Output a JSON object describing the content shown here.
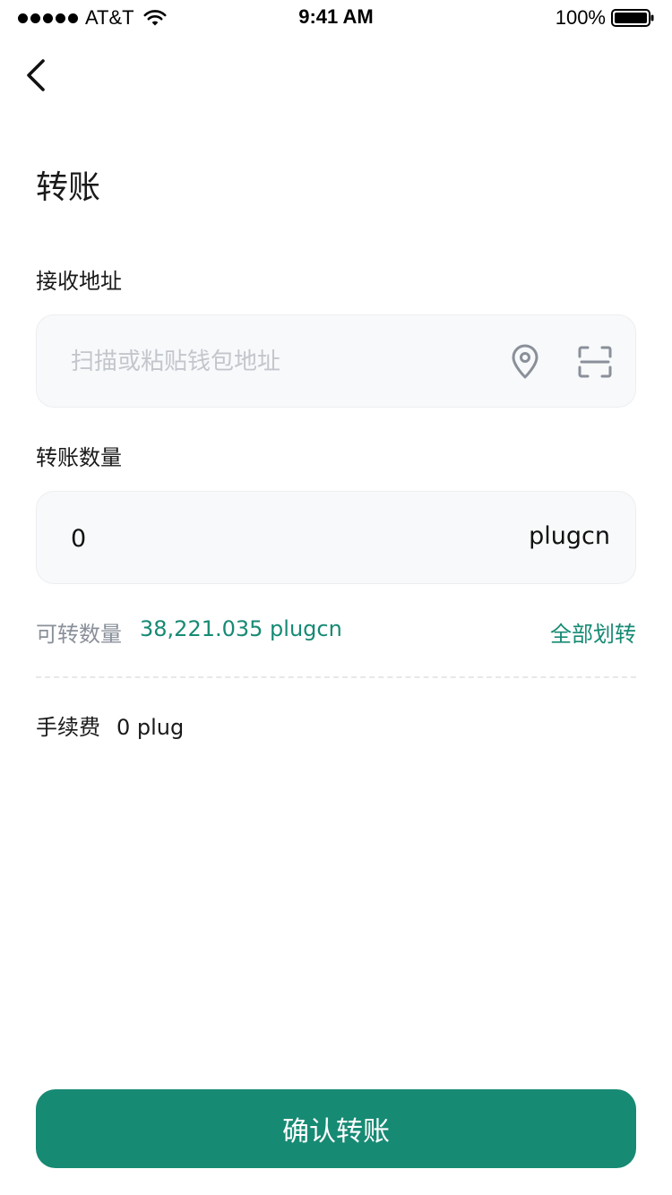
{
  "status_bar": {
    "carrier": "AT&T",
    "time": "9:41 AM",
    "battery": "100%"
  },
  "nav": {
    "back_icon": "chevron-left-icon"
  },
  "page": {
    "title": "转账"
  },
  "address": {
    "label": "接收地址",
    "placeholder": "扫描或粘贴钱包地址",
    "value": "",
    "icons": [
      "location-pin-icon",
      "scan-icon"
    ]
  },
  "amount": {
    "label": "转账数量",
    "value": "0",
    "unit": "plugcn"
  },
  "available": {
    "label": "可转数量",
    "value": "38,221.035 plugcn",
    "transfer_all": "全部划转"
  },
  "fee": {
    "label": "手续费",
    "value": "0 plug"
  },
  "confirm_button": {
    "label": "确认转账"
  },
  "colors": {
    "accent": "#178a74",
    "input_bg": "#f8f9fa",
    "muted_text": "#8a909a",
    "placeholder": "#c3c6cc"
  }
}
